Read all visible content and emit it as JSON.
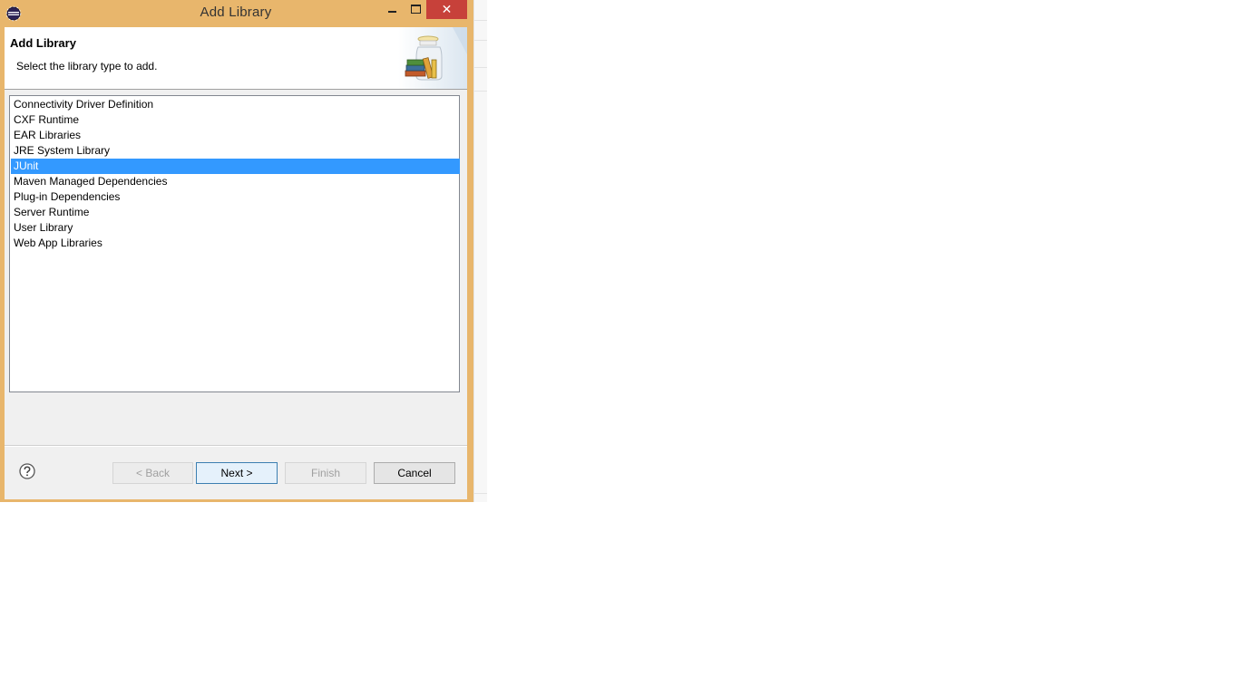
{
  "window": {
    "title": "Add Library",
    "close_glyph": "✕"
  },
  "header": {
    "title": "Add Library",
    "description": "Select the library type to add."
  },
  "library_types": [
    {
      "label": "Connectivity Driver Definition",
      "selected": false
    },
    {
      "label": "CXF Runtime",
      "selected": false
    },
    {
      "label": "EAR Libraries",
      "selected": false
    },
    {
      "label": "JRE System Library",
      "selected": false
    },
    {
      "label": "JUnit",
      "selected": true
    },
    {
      "label": "Maven Managed Dependencies",
      "selected": false
    },
    {
      "label": "Plug-in Dependencies",
      "selected": false
    },
    {
      "label": "Server Runtime",
      "selected": false
    },
    {
      "label": "User Library",
      "selected": false
    },
    {
      "label": "Web App Libraries",
      "selected": false
    }
  ],
  "buttons": {
    "back": {
      "label": "< Back",
      "enabled": false
    },
    "next": {
      "label": "Next >",
      "enabled": true
    },
    "finish": {
      "label": "Finish",
      "enabled": false
    },
    "cancel": {
      "label": "Cancel",
      "enabled": true
    }
  },
  "icons": {
    "app": "eclipse-icon",
    "help": "help-icon",
    "banner": "library-jar-icon"
  },
  "colors": {
    "window_frame": "#e8b66c",
    "close_button": "#c7413a",
    "selection": "#3399ff"
  }
}
